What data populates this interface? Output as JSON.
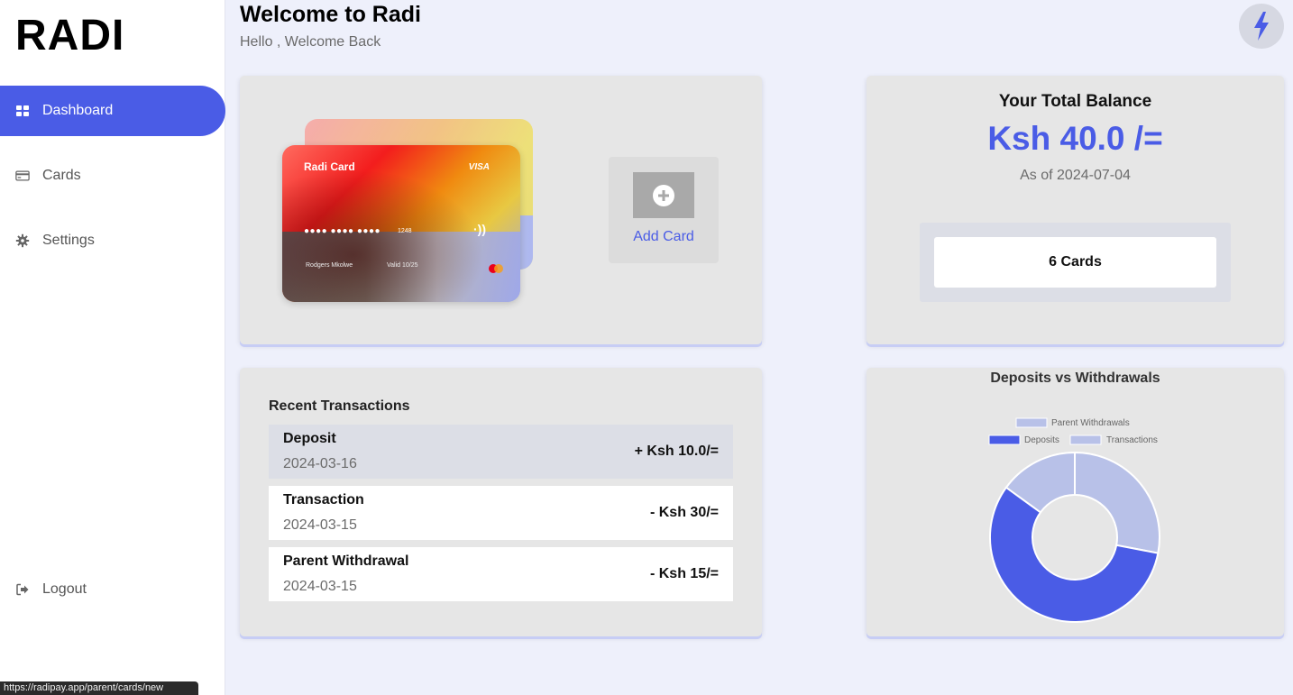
{
  "app": {
    "logo": "RADI"
  },
  "sidebar": {
    "items": [
      {
        "label": "Dashboard",
        "icon": "grid-icon",
        "active": true
      },
      {
        "label": "Cards",
        "icon": "credit-card-icon",
        "active": false
      },
      {
        "label": "Settings",
        "icon": "gear-icon",
        "active": false
      }
    ],
    "logout": {
      "label": "Logout",
      "icon": "logout-icon"
    }
  },
  "status_bar": {
    "url": "https://radipay.app/parent/cards/new"
  },
  "header": {
    "title": "Welcome to Radi",
    "subtitle": "Hello , Welcome Back",
    "action_icon": "bolt-icon"
  },
  "card_preview": {
    "name": "Radi Card",
    "brand": "VISA",
    "number_mask": "●●●● ●●●● ●●●●",
    "last4": "1248",
    "holder": "Rodgers Mkolwe",
    "valid": "Valid 10/25"
  },
  "add_card": {
    "label": "Add Card",
    "icon": "plus-circle-icon"
  },
  "balance": {
    "title": "Your Total Balance",
    "amount": "Ksh 40.0 /=",
    "as_of": "As of 2024-07-04",
    "cards_count": "6 Cards"
  },
  "transactions": {
    "title": "Recent Transactions",
    "rows": [
      {
        "name": "Deposit",
        "date": "2024-03-16",
        "amount": "+ Ksh 10.0/="
      },
      {
        "name": "Transaction",
        "date": "2024-03-15",
        "amount": "- Ksh 30/="
      },
      {
        "name": "Parent Withdrawal",
        "date": "2024-03-15",
        "amount": "- Ksh 15/="
      }
    ]
  },
  "colors": {
    "accent": "#4a5ce6",
    "accent_light": "#b8c1e8",
    "panel": "#e6e6e6",
    "page_bg": "#eef0fb"
  },
  "chart_data": {
    "type": "pie",
    "title": "Deposits vs Withdrawals",
    "legend": [
      {
        "name": "Parent Withdrawals",
        "color": "#b8c1e8"
      },
      {
        "name": "Deposits",
        "color": "#4a5ce6"
      },
      {
        "name": "Transactions",
        "color": "#b8c1e8"
      }
    ],
    "legend_position": "top",
    "slices": [
      {
        "name": "Parent Withdrawals",
        "value": 28,
        "color": "#b8c1e8"
      },
      {
        "name": "Deposits",
        "value": 57,
        "color": "#4a5ce6"
      },
      {
        "name": "Transactions",
        "value": 15,
        "color": "#b8c1e8"
      }
    ]
  }
}
